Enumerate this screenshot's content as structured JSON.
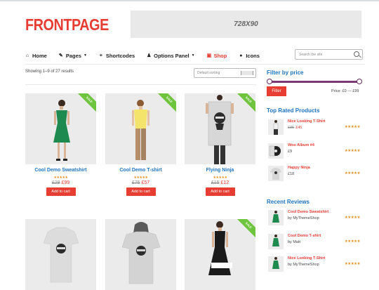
{
  "logo": "FRONTPAGE",
  "ad_banner": "728X90",
  "nav": [
    {
      "label": "Home",
      "icon": "home-icon",
      "glyph": "⌂"
    },
    {
      "label": "Pages",
      "icon": "paperclip-icon",
      "glyph": "✎",
      "caret": true
    },
    {
      "label": "Shortcodes",
      "icon": "plus-icon",
      "glyph": "+"
    },
    {
      "label": "Options Panel",
      "icon": "flask-icon",
      "glyph": "♟",
      "caret": true
    },
    {
      "label": "Shop",
      "icon": "cart-icon",
      "glyph": "▣",
      "active": true
    },
    {
      "label": "Icons",
      "icon": "apple-icon",
      "glyph": "●"
    }
  ],
  "search": {
    "placeholder": "Search the site"
  },
  "shop": {
    "result_count": "Showing 1–9 of 27 results",
    "sort_label": "Default sorting",
    "products": [
      {
        "title": "Cool Demo Sweatshirt",
        "old_price": "£29",
        "price": "£99",
        "sale_label": "SALE",
        "cart_label": "Add to cart",
        "rating": 5
      },
      {
        "title": "Cool Demo T-shirt",
        "old_price": "£75",
        "price": "£57",
        "sale_label": "SALE",
        "cart_label": "Add to cart",
        "rating": 5
      },
      {
        "title": "Flying Ninja",
        "old_price": "£15",
        "price": "£12",
        "sale_label": "SALE",
        "cart_label": "Add to cart",
        "rating": 5
      },
      {
        "title": "",
        "sale_label": ""
      },
      {
        "title": "",
        "sale_label": ""
      },
      {
        "title": "",
        "sale_label": "SALE"
      }
    ]
  },
  "sidebar": {
    "filter": {
      "title": "Filter by price",
      "button": "Filter",
      "range": "Price: £0 — £99"
    },
    "top_rated": {
      "title": "Top Rated Products",
      "items": [
        {
          "name": "Nice Looking T-Shirt",
          "old_price": "£35",
          "price": "£45",
          "rating": 5
        },
        {
          "name": "Woo Album #4",
          "price": "£9",
          "rating": 5
        },
        {
          "name": "Happy Ninja",
          "price": "£18",
          "rating": 5
        }
      ]
    },
    "reviews": {
      "title": "Recent Reviews",
      "items": [
        {
          "name": "Cool Demo Sweatshirt",
          "author": "by MyThemeShop",
          "rating": 5
        },
        {
          "name": "Cool Demo T-shirt",
          "author": "by Matt",
          "rating": 5
        },
        {
          "name": "Nice Looking T-Shirt",
          "author": "by MyThemeShop",
          "rating": 5
        }
      ]
    }
  },
  "stars": "★★★★★",
  "colors": {
    "accent": "#e73d32",
    "link": "#1e73be",
    "sale": "#6fc43e",
    "star": "#e79023",
    "slider": "#7a3a73"
  }
}
